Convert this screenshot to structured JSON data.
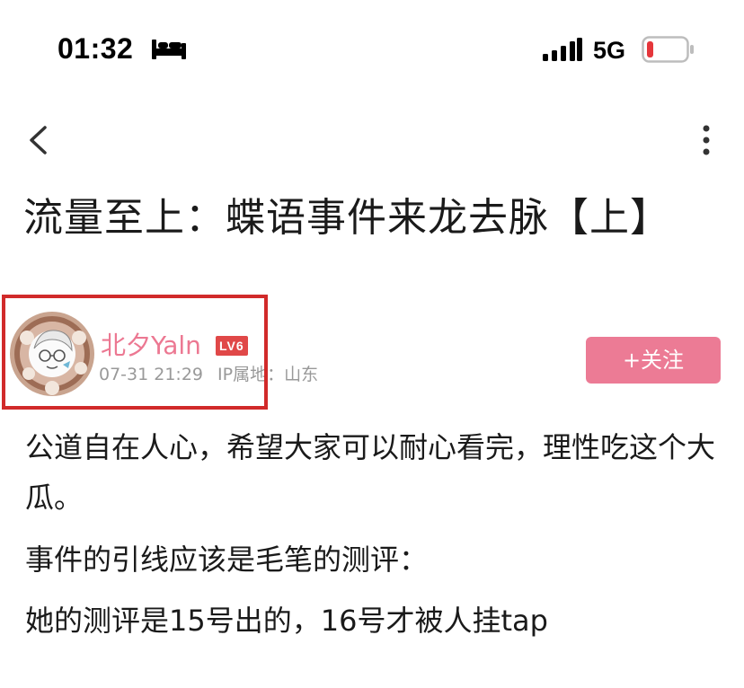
{
  "status_bar": {
    "time": "01:32",
    "network": "5G",
    "icons": [
      "bed-icon",
      "signal-icon",
      "battery-low-icon"
    ]
  },
  "nav": {
    "icons": [
      "back-chevron-icon",
      "more-vertical-icon"
    ]
  },
  "post": {
    "title": "流量至上：蝶语事件来龙去脉【上】",
    "author": {
      "name": "北夕Yaln",
      "level": "LV6",
      "date": "07-31 21:29",
      "ip_location": "IP属地：山东"
    },
    "follow_label": "+关注",
    "body": [
      "公道自在人心，希望大家可以耐心看完，理性吃这个大瓜。",
      "事件的引线应该是毛笔的测评：",
      "她的测评是15号出的，16号才被人挂tap"
    ]
  },
  "colors": {
    "accent_pink": "#ec7b95",
    "highlight_red": "#d12a2a",
    "meta_gray": "#999999"
  }
}
